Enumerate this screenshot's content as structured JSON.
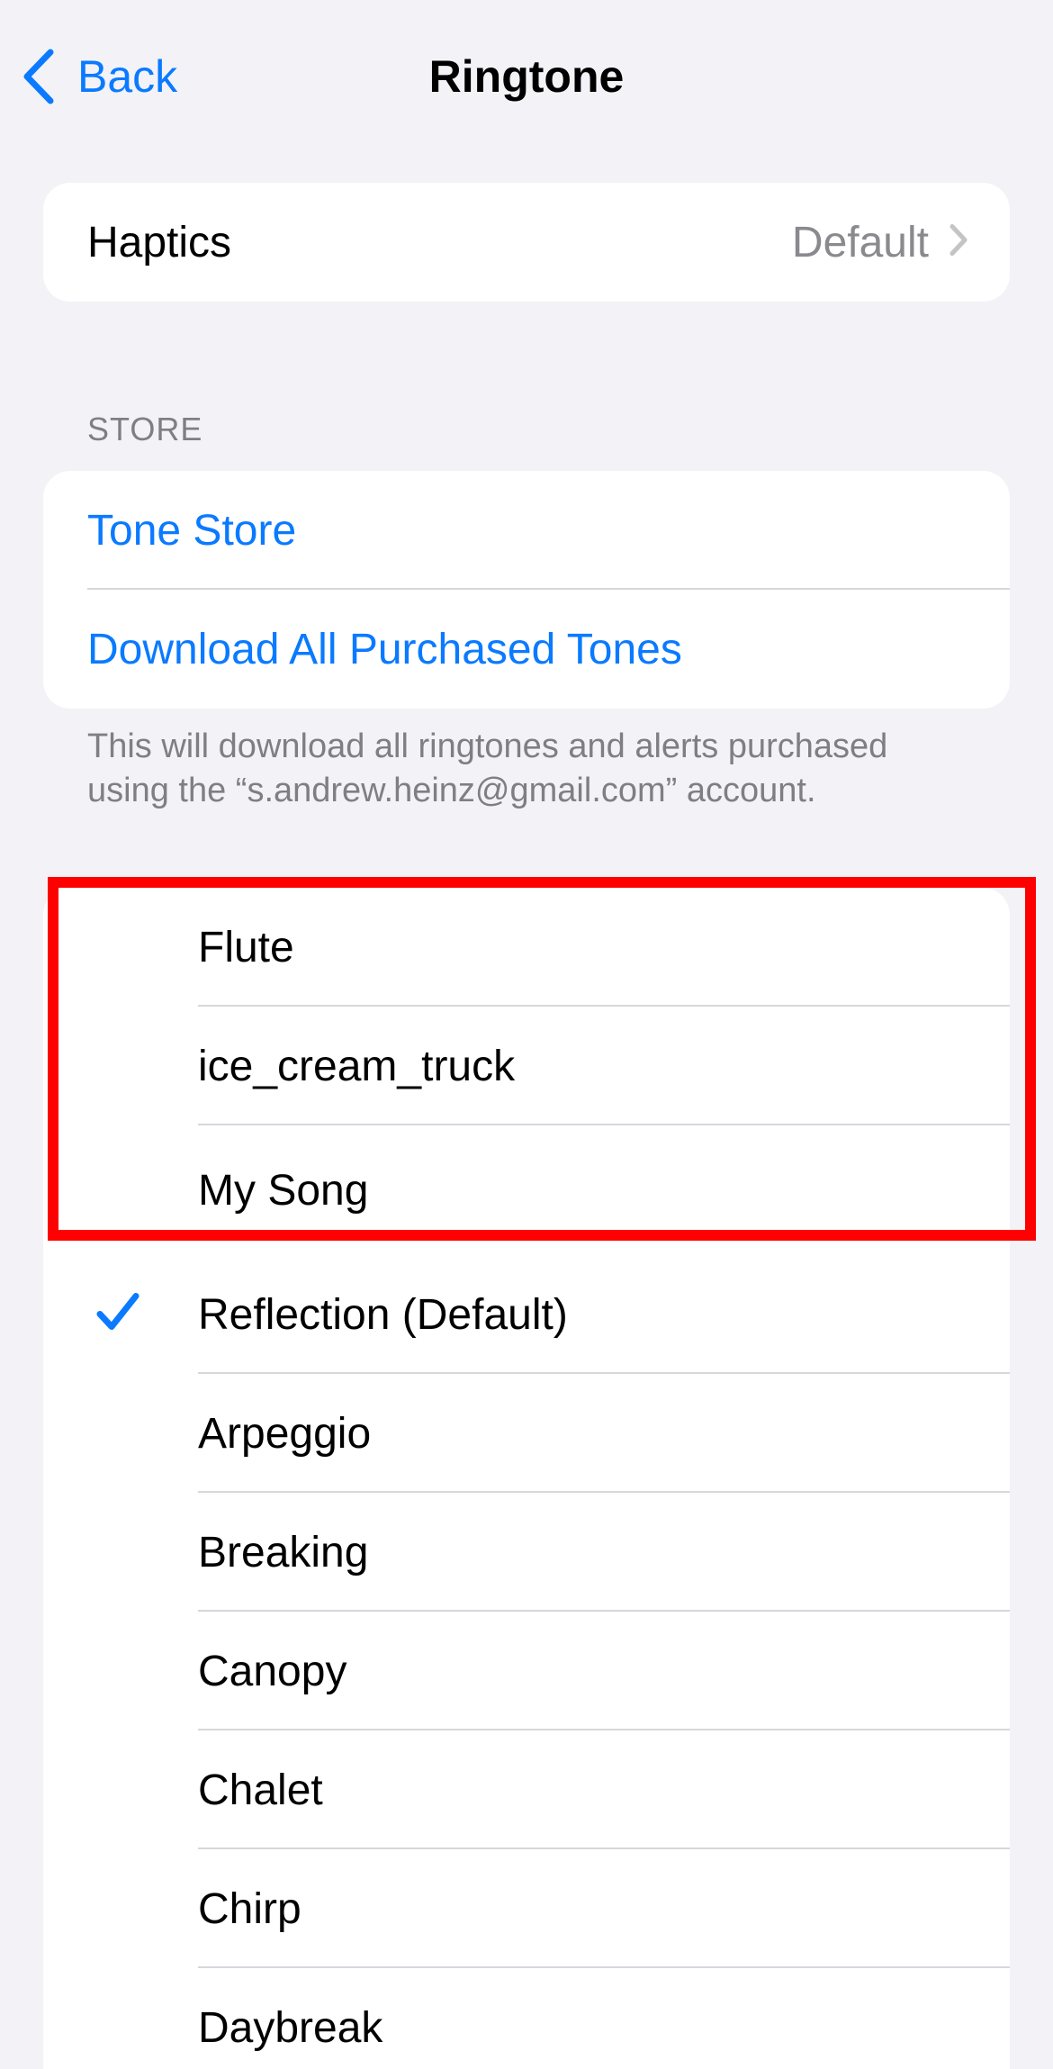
{
  "nav": {
    "back_label": "Back",
    "title": "Ringtone",
    "back_icon": "chevron-left-icon"
  },
  "haptics": {
    "label": "Haptics",
    "value": "Default",
    "icon": "chevron-right-icon"
  },
  "store": {
    "header": "STORE",
    "tone_store_label": "Tone Store",
    "download_all_label": "Download All Purchased Tones",
    "footer": "This will download all ringtones and alerts purchased using the “s.andrew.heinz@gmail.com” account."
  },
  "ringtones": {
    "selected": "Reflection (Default)",
    "items": [
      {
        "label": "Flute",
        "checked": false
      },
      {
        "label": "ice_cream_truck",
        "checked": false
      },
      {
        "label": "My Song",
        "checked": false
      },
      {
        "label": "Reflection (Default)",
        "checked": true
      },
      {
        "label": "Arpeggio",
        "checked": false
      },
      {
        "label": "Breaking",
        "checked": false
      },
      {
        "label": "Canopy",
        "checked": false
      },
      {
        "label": "Chalet",
        "checked": false
      },
      {
        "label": "Chirp",
        "checked": false
      },
      {
        "label": "Daybreak",
        "checked": false
      }
    ]
  },
  "colors": {
    "accent": "#0a7aff",
    "background": "#f2f2f7",
    "highlight": "#ff0000",
    "secondary_text": "#8a8a8e"
  }
}
